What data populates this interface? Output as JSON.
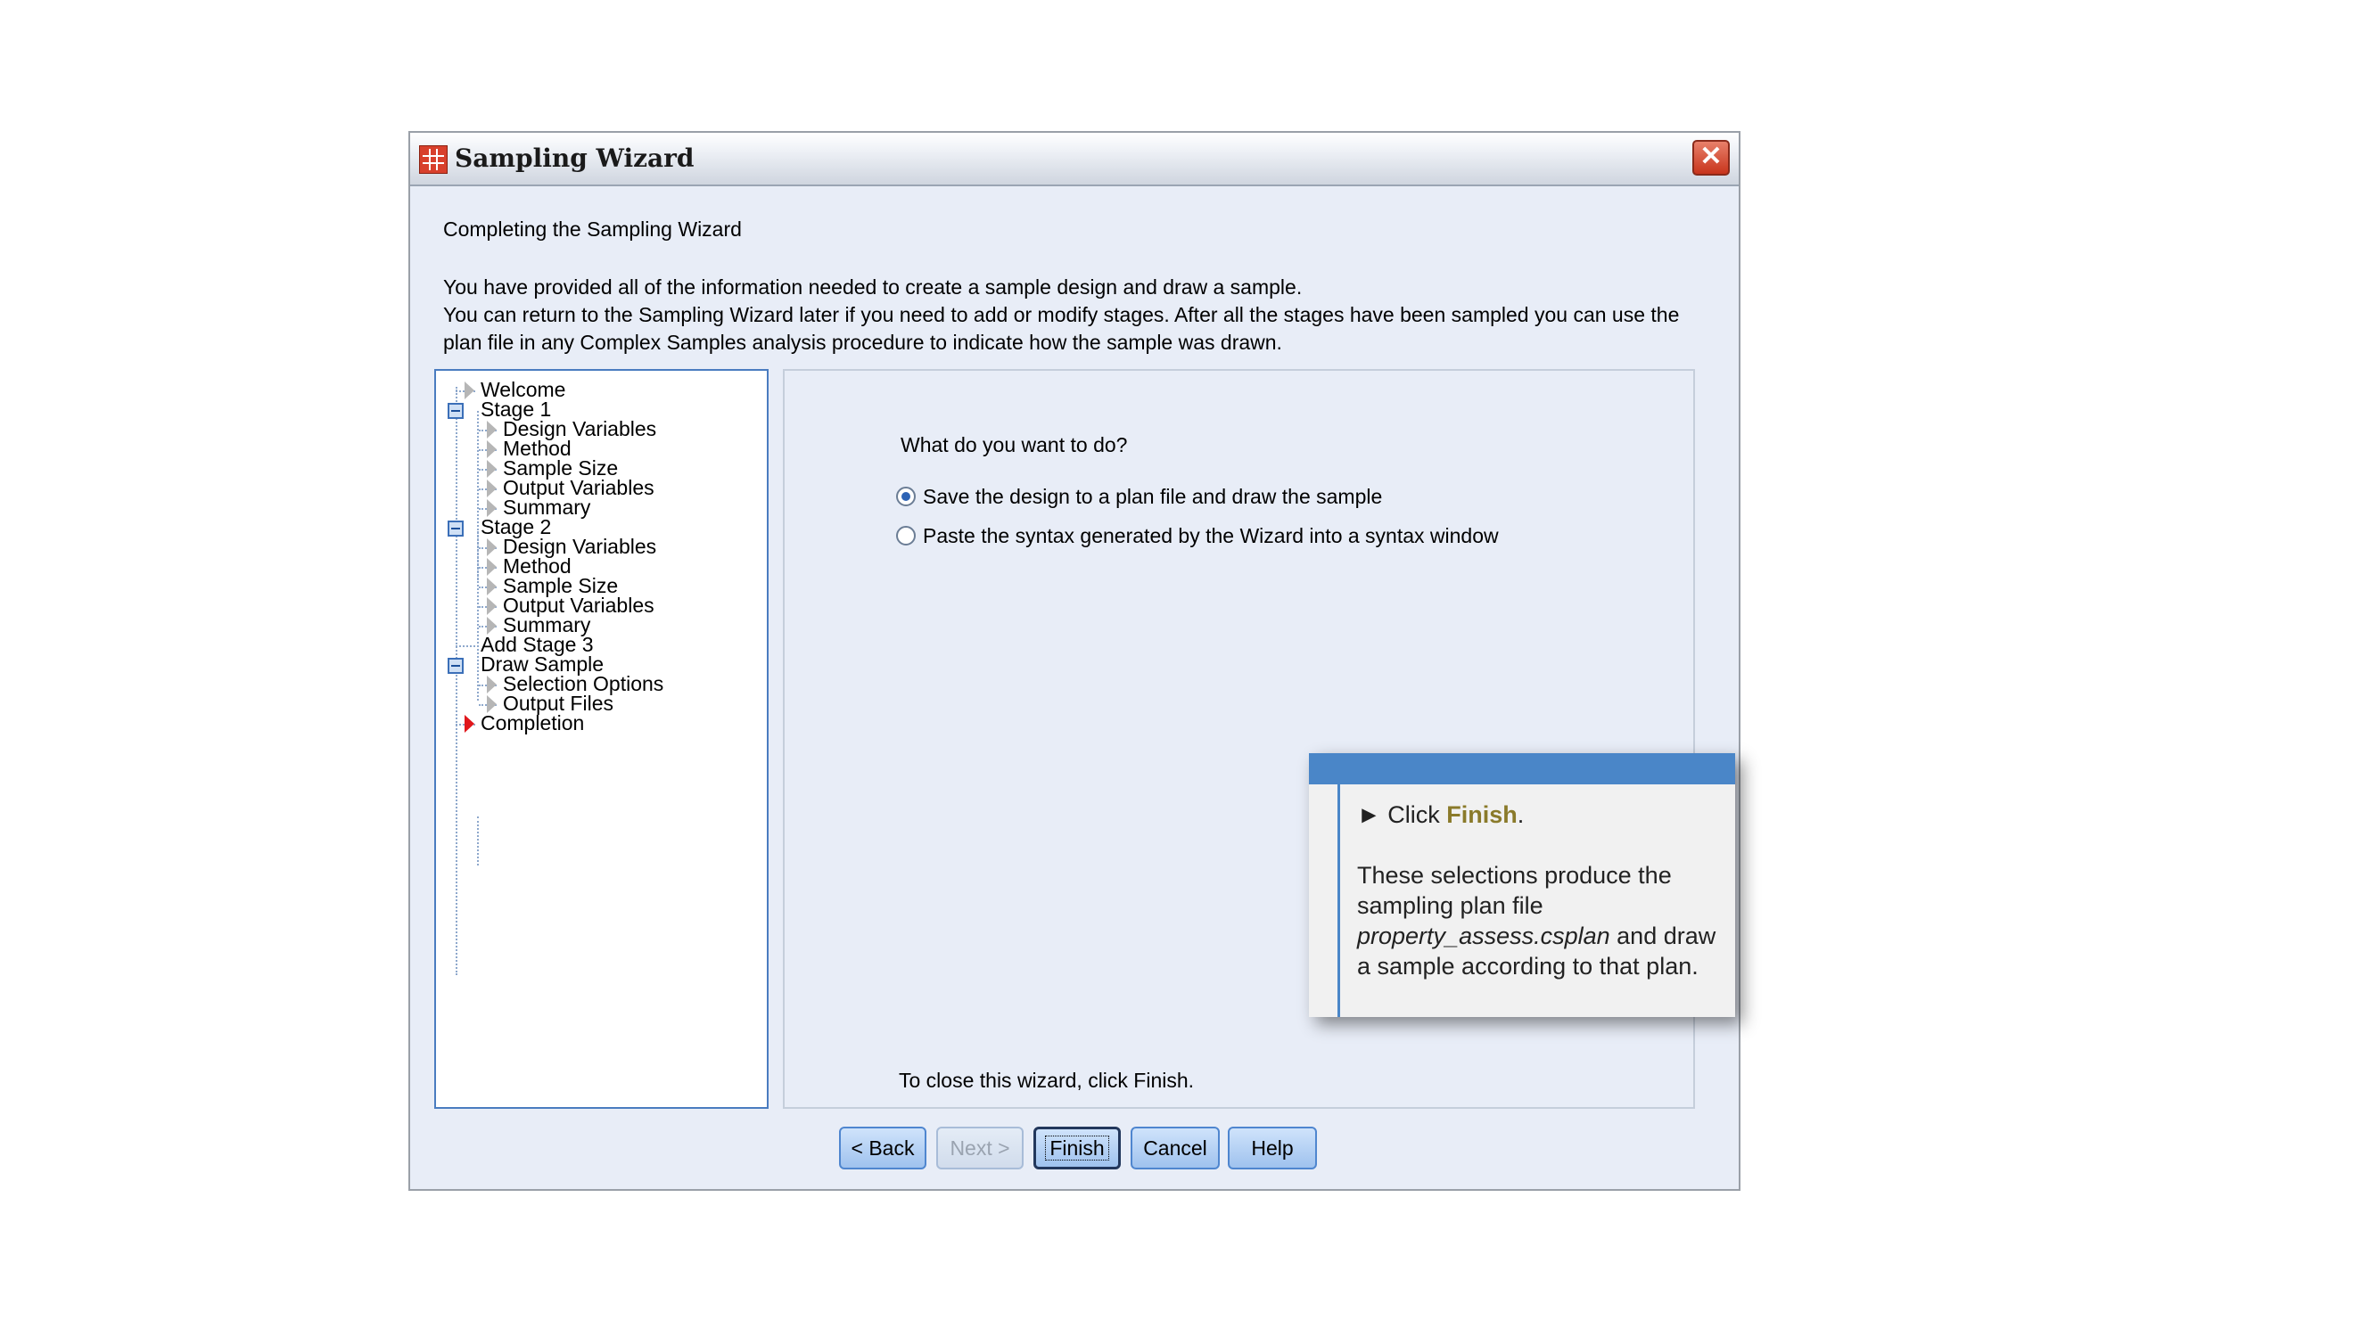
{
  "window": {
    "title": "Sampling Wizard",
    "close_symbol": "✕"
  },
  "heading": "Completing the Sampling Wizard",
  "description": [
    "You have provided all of the information needed to create a sample design and draw a sample.",
    "You can return to the Sampling Wizard later if you need to add or modify stages. After all the stages have been sampled you can use the",
    "plan file in any Complex Samples analysis procedure to indicate how the sample was drawn."
  ],
  "tree": {
    "welcome": "Welcome",
    "stage1": {
      "label": "Stage 1",
      "items": [
        "Design Variables",
        "Method",
        "Sample Size",
        "Output Variables",
        "Summary"
      ]
    },
    "stage2": {
      "label": "Stage 2",
      "items": [
        "Design Variables",
        "Method",
        "Sample Size",
        "Output Variables",
        "Summary"
      ]
    },
    "add_stage3": "Add Stage 3",
    "draw_sample": {
      "label": "Draw Sample",
      "items": [
        "Selection Options",
        "Output Files"
      ]
    },
    "completion": "Completion"
  },
  "content": {
    "question": "What do you want to do?",
    "options": [
      {
        "label": "Save the design to a plan file and draw the sample",
        "selected": true
      },
      {
        "label": "Paste the syntax generated by the Wizard into a syntax window",
        "selected": false
      }
    ],
    "close_note": "To close this wizard, click Finish."
  },
  "buttons": {
    "back": "< Back",
    "next": "Next >",
    "finish": "Finish",
    "cancel": "Cancel",
    "help": "Help"
  },
  "callout": {
    "step_prefix": "► Click ",
    "step_action": "Finish",
    "step_suffix": ".",
    "body_part1": "These selections produce the sampling plan file ",
    "filename": "property_assess.csplan",
    "body_part2": " and draw a sample according to that plan."
  }
}
